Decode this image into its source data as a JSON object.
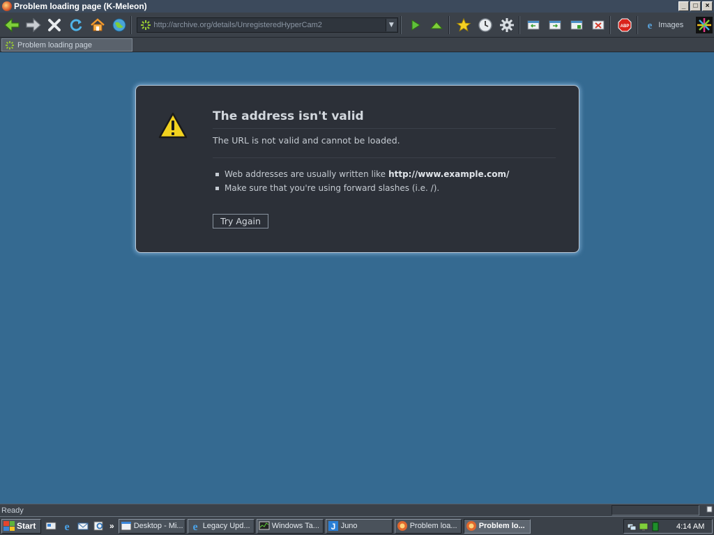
{
  "window": {
    "title": "Problem loading page (K-Meleon)"
  },
  "titlebar_buttons": {
    "minimize": "_",
    "maximize": "□",
    "close": "×"
  },
  "toolbar": {
    "url": "http://archive.org/details/UnregisteredHyperCam2",
    "dropdown_glyph": "▼",
    "images_label": "Images"
  },
  "tab": {
    "label": "Problem loading page"
  },
  "error": {
    "title": "The address isn't valid",
    "description": "The URL is not valid and cannot be loaded.",
    "bullets": [
      {
        "text": "Web addresses are usually written like",
        "bold": "http://www.example.com/"
      },
      {
        "text": "Make sure that you're using forward slashes (i.e. /).",
        "bold": ""
      }
    ],
    "try_again": "Try Again"
  },
  "statusbar": {
    "text": "Ready"
  },
  "taskbar": {
    "start": "Start",
    "chevron": "»",
    "tasks": [
      {
        "label": "Desktop - Mi..."
      },
      {
        "label": "Legacy Upd..."
      },
      {
        "label": "Windows Ta..."
      },
      {
        "label": "Juno"
      },
      {
        "label": "Problem loa..."
      },
      {
        "label": "Problem lo..."
      }
    ],
    "clock": "4:14 AM"
  },
  "colors": {
    "page_background": "#356a91",
    "error_box": "#2c3038",
    "error_glow": "#6f9ec4",
    "warning_yellow": "#f2d21f",
    "toolbar": "#3b4149"
  }
}
